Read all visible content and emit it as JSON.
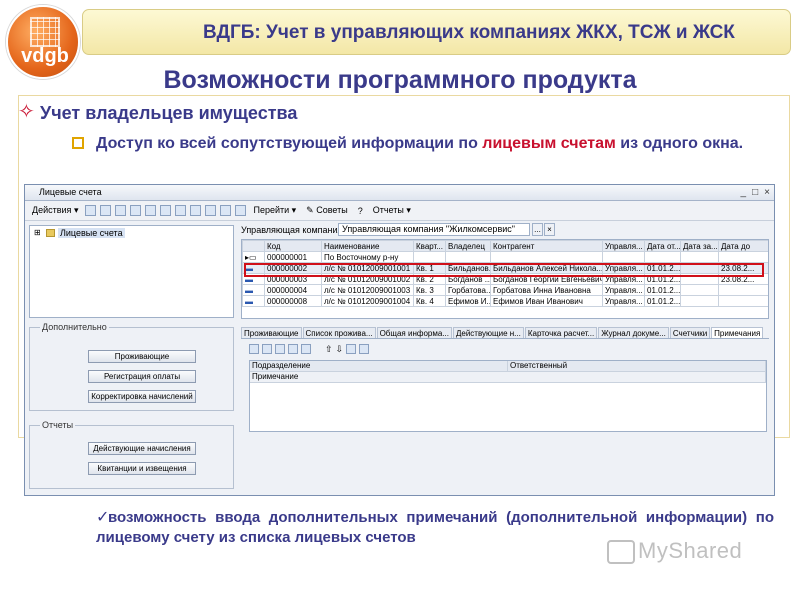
{
  "logo": {
    "text": "vdgb"
  },
  "banner": {
    "title": "ВДГБ: Учет в управляющих компаниях ЖКХ, ТСЖ и ЖСК"
  },
  "slide": {
    "heading": "Возможности программного продукта",
    "bullet1": "Учет владельцев имущества",
    "bullet2_part1": "Доступ ко всей сопутствующей информации по ",
    "bullet2_highlight": "лицевым счетам",
    "bullet2_part2": " из одного окна.",
    "note": "возможность ввода дополнительных примечаний (дополнительной информации) по лицевому счету из списка лицевых счетов",
    "accent_color": "#c8102e",
    "text_color": "#3a3a8a"
  },
  "window": {
    "title": "Лицевые счета",
    "controls": [
      "_",
      "□",
      "×"
    ],
    "toolbar": {
      "actions": "Действия",
      "navigate": "Перейти",
      "tips": "Советы",
      "help": "?",
      "reports": "Отчеты"
    },
    "tree": {
      "root": "Лицевые счета"
    },
    "org": {
      "label": "Управляющая компания:",
      "value": "Управляющая компания \"Жилкомсервис\"",
      "btn_select": "...",
      "btn_clear": "×"
    },
    "grid": {
      "columns": [
        "",
        "Код",
        "Наименование",
        "Кварт...",
        "Владелец",
        "Контрагент",
        "Управля...",
        "Дата от...",
        "Дата за...",
        "Дата до"
      ],
      "rows": [
        [
          "",
          "000000001",
          "По Восточному р-ну",
          "",
          "",
          "",
          "",
          "",
          "",
          ""
        ],
        [
          "",
          "000000002",
          "л/с № 01012009001001",
          "Кв. 1",
          "Бильданов...",
          "Бильданов Алексей Никола...",
          "Управля...",
          "01.01.2...",
          "",
          "23.08.2..."
        ],
        [
          "",
          "000000003",
          "л/с № 01012009001002",
          "Кв. 2",
          "Богданов ...",
          "Богданов Георгий Евгеньевич",
          "Управля...",
          "01.01.2...",
          "",
          "23.08.2..."
        ],
        [
          "",
          "000000004",
          "л/с № 01012009001003",
          "Кв. 3",
          "Горбатова...",
          "Горбатова Инна Ивановна",
          "Управля...",
          "01.01.2...",
          "",
          ""
        ],
        [
          "",
          "000000008",
          "л/с № 01012009001004",
          "Кв. 4",
          "Ефимов И...",
          "Ефимов Иван Иванович",
          "Управля...",
          "01.01.2...",
          "",
          ""
        ]
      ]
    },
    "extra_panel": {
      "label": "Дополнительно",
      "buttons": [
        "Проживающие",
        "Регистрация оплаты",
        "Корректировка начислений"
      ]
    },
    "reports_panel": {
      "label": "Отчеты",
      "buttons": [
        "Действующие начисления",
        "Квитанции и извещения"
      ]
    },
    "tabs": [
      "Проживающие",
      "Список прожива...",
      "Общая информа...",
      "Действующие н...",
      "Карточка расчет...",
      "Журнал докуме...",
      "Счетчики",
      "Примечания"
    ],
    "active_tab": 7,
    "notes_grid": {
      "columns": [
        "Подразделение",
        "Ответственный"
      ],
      "row_label": "Примечание"
    }
  },
  "watermark": {
    "text": "MyShared"
  }
}
